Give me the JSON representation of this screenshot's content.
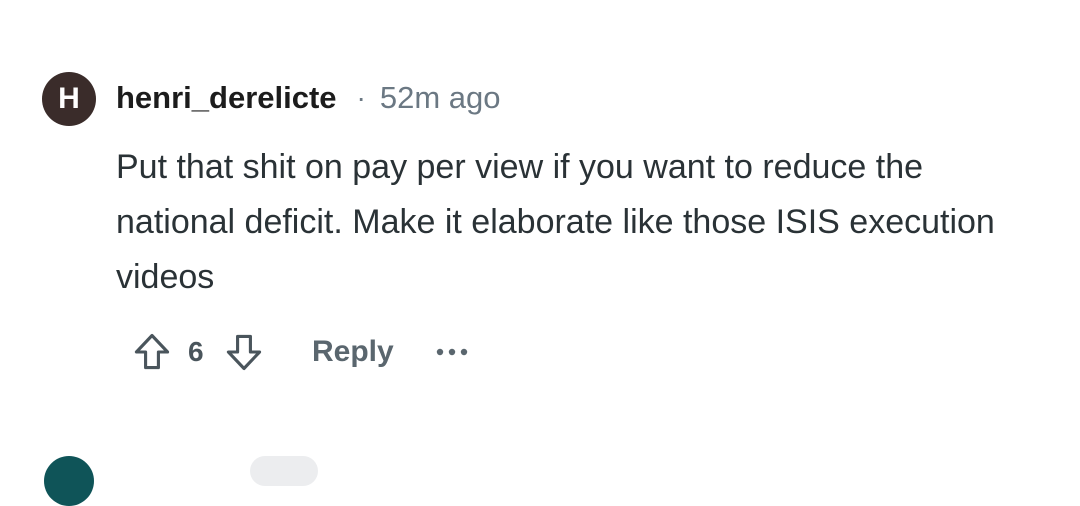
{
  "comment": {
    "avatar_letter": "H",
    "username": "henri_derelicte",
    "separator": "·",
    "time": "52m ago",
    "body": "Put that shit on pay per view if you want to reduce the national deficit. Make it elaborate like those ISIS execution videos",
    "score": "6",
    "reply_label": "Reply",
    "icons": {
      "upvote": "arrow-up-outline-icon",
      "downvote": "arrow-down-outline-icon",
      "more": "ellipsis-icon"
    }
  },
  "colors": {
    "avatar_bg": "#3a2c2a",
    "next_avatar_bg": "#0f5458",
    "meta_gray": "#6b7883",
    "body_text": "#2a3236"
  }
}
